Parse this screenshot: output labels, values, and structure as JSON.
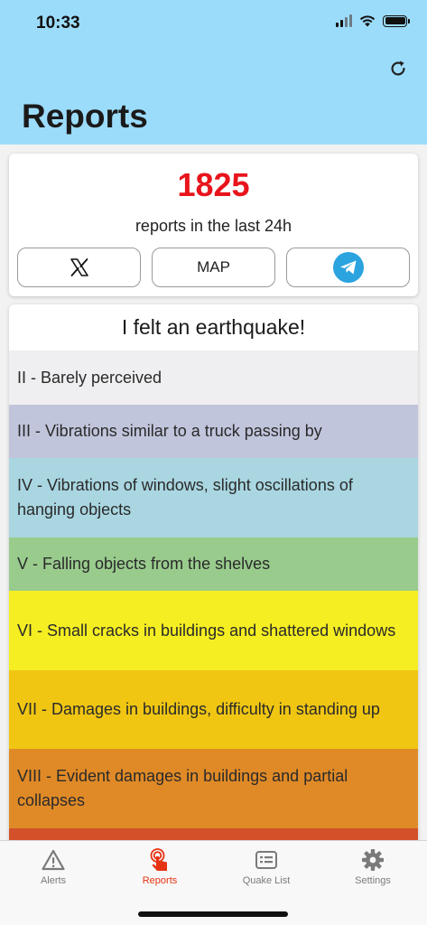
{
  "status": {
    "time": "10:33"
  },
  "header": {
    "title": "Reports"
  },
  "summary": {
    "count": "1825",
    "caption": "reports in the last 24h",
    "map_label": "MAP"
  },
  "felt": {
    "title": "I felt an earthquake!",
    "levels": [
      {
        "label": "II - Barely perceived",
        "color": "#efeff1"
      },
      {
        "label": "III - Vibrations similar to a truck passing by",
        "color": "#c1c5dc"
      },
      {
        "label": "IV - Vibrations of windows, slight oscillations of hanging objects",
        "color": "#a9d6e1"
      },
      {
        "label": "V - Falling objects from the shelves",
        "color": "#99cb8d"
      },
      {
        "label": "VI - Small cracks in buildings and shattered windows",
        "color": "#f5ee22"
      },
      {
        "label": "VII - Damages in buildings, difficulty in standing up",
        "color": "#f0c613"
      },
      {
        "label": "VIII - Evident damages in buildings and partial collapses",
        "color": "#e08a27"
      }
    ]
  },
  "tabs": [
    {
      "label": "Alerts",
      "icon": "warning-icon"
    },
    {
      "label": "Reports",
      "icon": "touch-icon",
      "active": true
    },
    {
      "label": "Quake List",
      "icon": "list-icon"
    },
    {
      "label": "Settings",
      "icon": "gear-icon"
    }
  ]
}
